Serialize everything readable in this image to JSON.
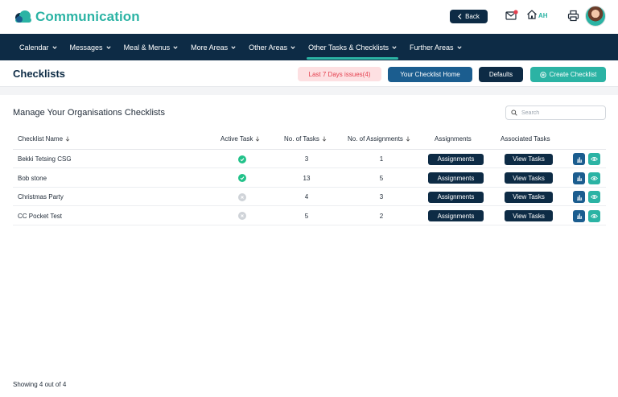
{
  "header": {
    "brand": "Communication",
    "back_label": "Back",
    "user_initials": "AH"
  },
  "nav": {
    "items": [
      {
        "label": "Calendar"
      },
      {
        "label": "Messages"
      },
      {
        "label": "Meal & Menus"
      },
      {
        "label": "More Areas"
      },
      {
        "label": "Other Areas"
      },
      {
        "label": "Other Tasks & Checklists",
        "active": true
      },
      {
        "label": "Further Areas"
      }
    ]
  },
  "page": {
    "title": "Checklists",
    "issues_label": "Last 7 Days issues(4)",
    "home_label": "Your Checklist Home",
    "defaults_label": "Defaults",
    "create_label": "Create Checklist"
  },
  "main": {
    "section_title": "Manage Your Organisations Checklists",
    "search_placeholder": "Search",
    "columns": {
      "name": "Checklist Name",
      "active": "Active Task",
      "tasks": "No. of Tasks",
      "assignments_count": "No. of Assignments",
      "assignments": "Assignments",
      "associated": "Associated Tasks"
    },
    "rows": [
      {
        "name": "Bekki Tetsing CSG",
        "active": true,
        "tasks": "3",
        "assignments": "1",
        "assign_btn": "Assignments",
        "tasks_btn": "View Tasks"
      },
      {
        "name": "Bob stone",
        "active": true,
        "tasks": "13",
        "assignments": "5",
        "assign_btn": "Assignments",
        "tasks_btn": "View Tasks"
      },
      {
        "name": "Christmas Party",
        "active": false,
        "tasks": "4",
        "assignments": "3",
        "assign_btn": "Assignments",
        "tasks_btn": "View Tasks"
      },
      {
        "name": "CC Pocket Test",
        "active": false,
        "tasks": "5",
        "assignments": "2",
        "assign_btn": "Assignments",
        "tasks_btn": "View Tasks"
      }
    ],
    "footer": "Showing 4 out of 4"
  },
  "colors": {
    "navy": "#0d2b45",
    "teal": "#2bb3a4",
    "blue": "#1b5d8f",
    "active_green": "#22c28a",
    "inactive_grey": "#cfd3d8",
    "issues_bg": "#fde0e2",
    "issues_text": "#e5404f"
  },
  "icons": {
    "logo": "cloud-logo-icon",
    "back": "chevron-left-icon",
    "mail": "mail-notification-icon",
    "home": "home-icon",
    "print": "printer-icon",
    "create": "plus-circle-icon",
    "search": "search-icon",
    "sort": "arrow-down-icon",
    "stats": "bar-chart-icon",
    "view": "eye-icon"
  }
}
